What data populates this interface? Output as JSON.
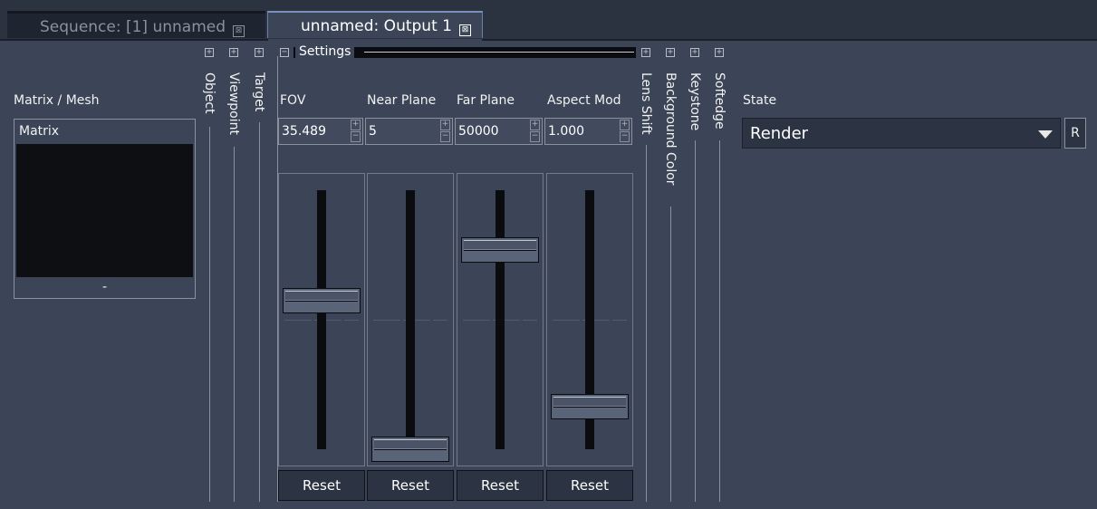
{
  "tabs": [
    {
      "label": "Sequence: [1] unnamed",
      "close": "⊠",
      "active": false
    },
    {
      "label": "unnamed: Output 1",
      "close": "⊠",
      "active": true
    }
  ],
  "collapsed_sections": [
    "Object",
    "Viewpoint",
    "Target"
  ],
  "right_sections": [
    "Lens Shift",
    "Background Color",
    "Keystone",
    "Softedge"
  ],
  "expand_symbol": "+",
  "collapse_symbol": "−",
  "settings": {
    "label": "Settings"
  },
  "matrix_mesh": {
    "label": "Matrix / Mesh",
    "item": "Matrix",
    "footer": "-"
  },
  "params": [
    {
      "label": "FOV",
      "value": "35.489",
      "level": 0.59,
      "reset": "Reset"
    },
    {
      "label": "Near Plane",
      "value": "5",
      "level": 0.0,
      "reset": "Reset"
    },
    {
      "label": "Far Plane",
      "value": "50000",
      "level": 0.79,
      "reset": "Reset"
    },
    {
      "label": "Aspect Mod",
      "value": "1.000",
      "level": 0.17,
      "reset": "Reset"
    }
  ],
  "stepper": {
    "up": "+",
    "down": "−"
  },
  "state": {
    "label": "State",
    "value": "Render",
    "r_button": "R"
  },
  "colors": {
    "background": "#3b4557",
    "tabbar": "#2b3240",
    "field": "#2c3443",
    "active_tab_border": "#7a8fc0"
  }
}
